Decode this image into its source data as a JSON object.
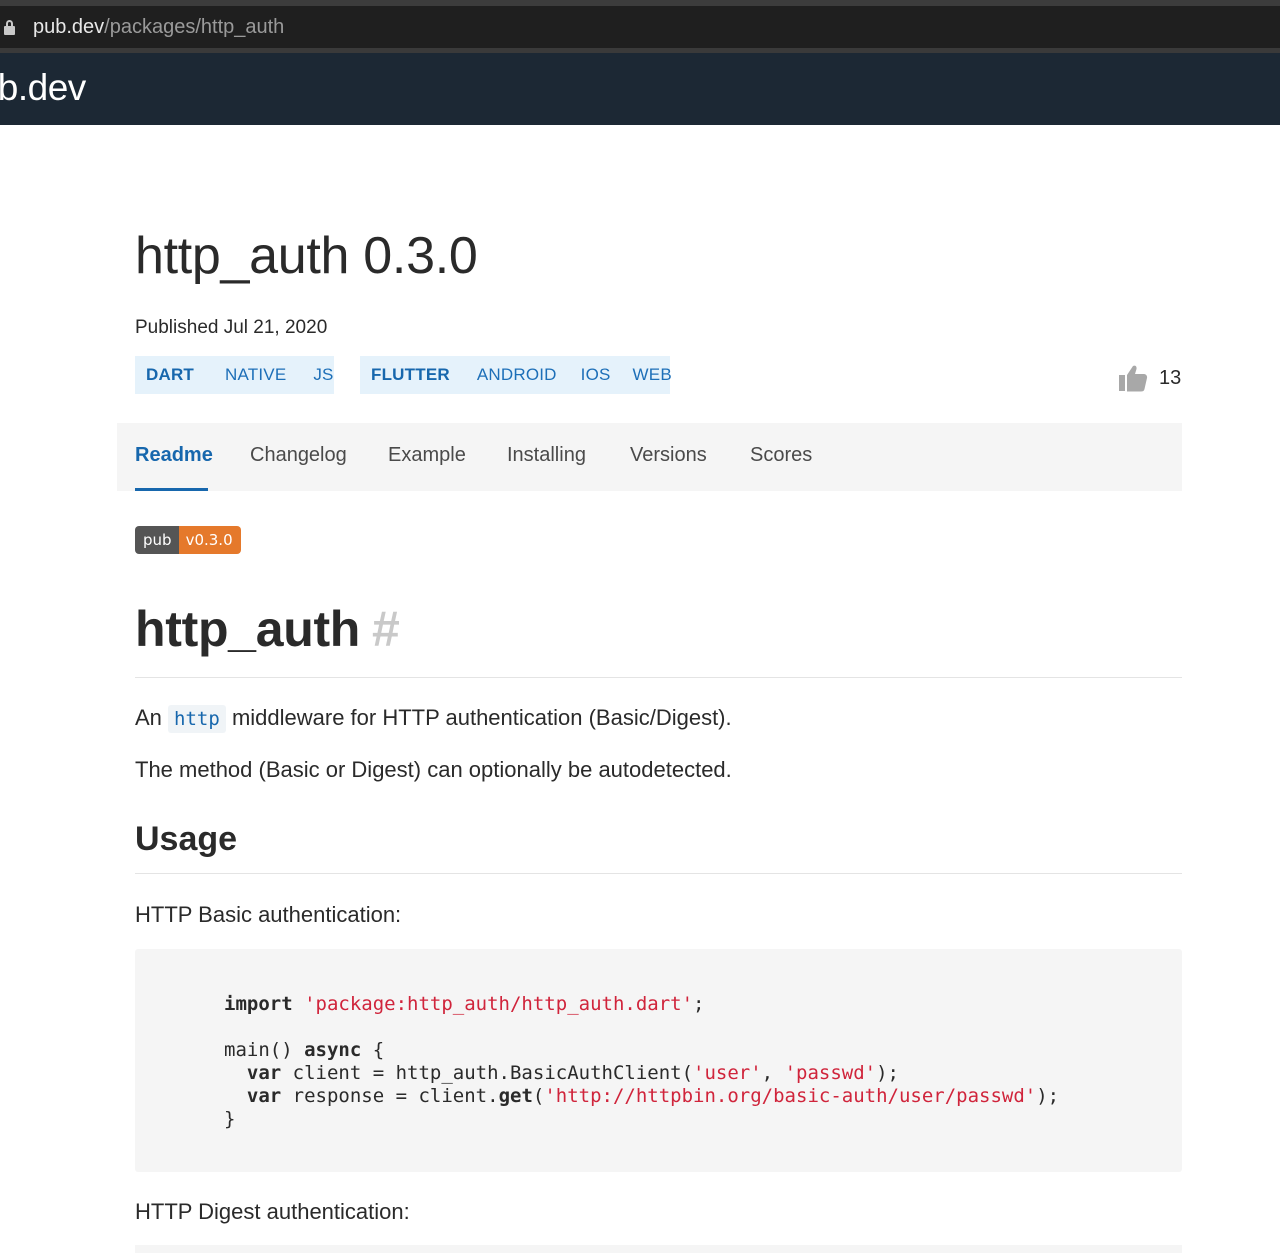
{
  "browser": {
    "url_host": "pub.dev",
    "url_path": "/packages/http_auth"
  },
  "site": {
    "logo": "pub.dev",
    "logo_visible": "ıb.dev"
  },
  "package": {
    "title": "http_auth 0.3.0",
    "published": "Published Jul 21, 2020",
    "sdk_tags": {
      "dart": {
        "primary": "DART",
        "platforms": [
          "NATIVE",
          "JS"
        ]
      },
      "flutter": {
        "primary": "FLUTTER",
        "platforms": [
          "ANDROID",
          "IOS",
          "WEB"
        ]
      }
    },
    "likes": "13"
  },
  "tabs": [
    "Readme",
    "Changelog",
    "Example",
    "Installing",
    "Versions",
    "Scores"
  ],
  "active_tab": "Readme",
  "badge": {
    "label": "pub",
    "version": "v0.3.0"
  },
  "readme": {
    "heading": "http_auth",
    "anchor": "#",
    "intro_before": "An",
    "intro_code": "http",
    "intro_after": "middleware for HTTP authentication (Basic/Digest).",
    "autodetect": "The method (Basic or Digest) can optionally be autodetected.",
    "usage_heading": "Usage",
    "basic_heading": "HTTP Basic authentication:",
    "basic_code": {
      "l1_kw": "import",
      "l1_str": "'package:http_auth/http_auth.dart'",
      "l1_end": ";",
      "l2": "main() ",
      "l2_kw": "async",
      "l2_end": " {",
      "l3_kw": "var",
      "l3_a": " client = http_auth.BasicAuthClient(",
      "l3_s1": "'user'",
      "l3_b": ", ",
      "l3_s2": "'passwd'",
      "l3_end": ");",
      "l4_kw": "var",
      "l4_a": " response = client.",
      "l4_kw2": "get",
      "l4_b": "(",
      "l4_s": "'http://httpbin.org/basic-auth/user/passwd'",
      "l4_end": ");",
      "l5": "}"
    },
    "digest_heading": "HTTP Digest authentication:"
  },
  "colors": {
    "header_bg": "#1c2834",
    "accent": "#1767ad",
    "tag_bg": "#e5f2fb",
    "badge_version": "#e5792b",
    "string": "#d0243b"
  }
}
